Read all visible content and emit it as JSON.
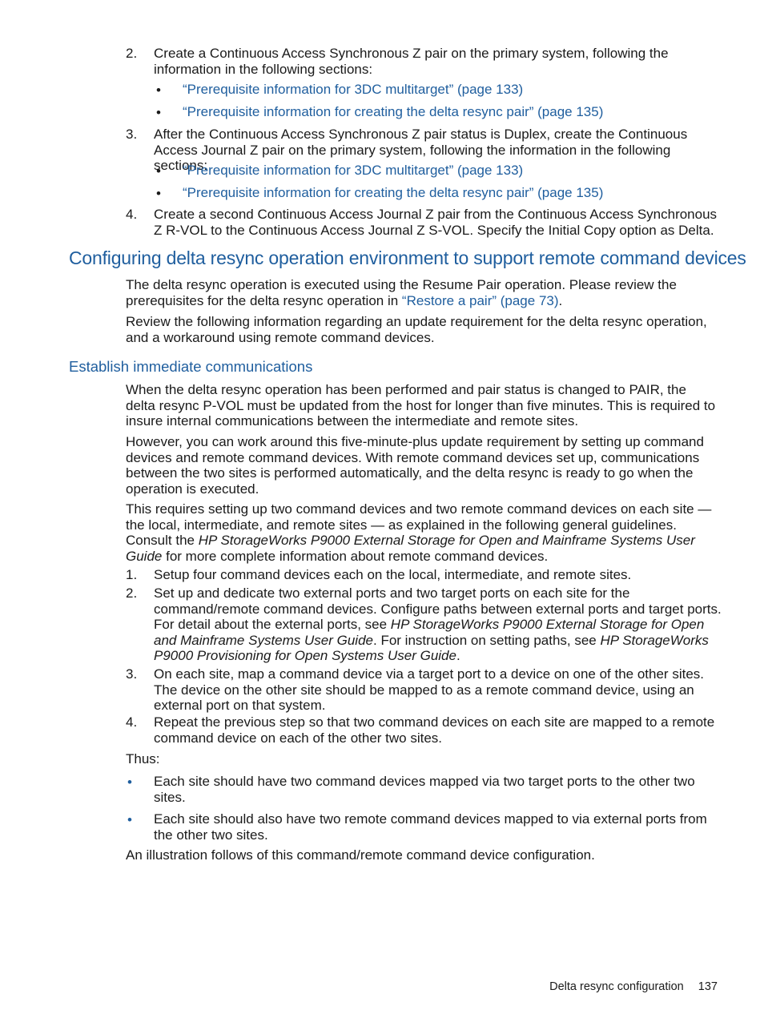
{
  "list_top": [
    {
      "number": "2.",
      "text": "Create a Continuous Access Synchronous Z pair on the primary system, following the information in the following sections:",
      "links": [
        "“Prerequisite information for 3DC multitarget” (page 133)",
        "“Prerequisite information for creating the delta resync pair” (page 135)"
      ]
    },
    {
      "number": "3.",
      "text": "After the Continuous Access Synchronous Z pair status is Duplex, create the Continuous Access Journal Z pair on the primary system, following the information in the following sections:",
      "links": [
        "“Prerequisite information for 3DC multitarget” (page 133)",
        "“Prerequisite information for creating the delta resync pair” (page 135)"
      ]
    },
    {
      "number": "4.",
      "text": "Create a second Continuous Access Journal Z pair from the Continuous Access Synchronous Z R-VOL to the Continuous Access Journal Z S-VOL. Specify the Initial Copy option as Delta."
    }
  ],
  "section": {
    "heading": "Configuring delta resync operation environment to support remote command devices",
    "para1_before": "The delta resync operation is executed using the Resume Pair operation. Please review the prerequisites for the delta resync operation in ",
    "para1_link": "“Restore a pair” (page 73)",
    "para1_after": ".",
    "para2": "Review the following information regarding an update requirement for the delta resync operation, and a workaround using remote command devices."
  },
  "subsection": {
    "heading": "Establish immediate communications",
    "para1": "When the delta resync operation has been performed and pair status is changed to PAIR, the delta resync P-VOL must be updated from the host for longer than five minutes. This is required to insure internal communications between the intermediate and remote sites.",
    "para2": "However, you can work around this five-minute-plus update requirement by setting up command devices and remote command devices. With remote command devices set up, communications between the two sites is performed automatically, and the delta resync is ready to go when the operation is executed.",
    "para3_before": "This requires setting up two command devices and two remote command devices on each site — the local, intermediate, and remote sites — as explained in the following general guidelines. Consult the ",
    "para3_italic": "HP StorageWorks P9000 External Storage for Open and Mainframe Systems User Guide",
    "para3_after": " for more complete information about remote command devices.",
    "steps": [
      {
        "number": "1.",
        "text": "Setup four command devices each on the local, intermediate, and remote sites."
      },
      {
        "number": "2.",
        "t1": "Set up and dedicate two external ports and two target ports on each site for the command/remote command devices. Configure paths between external ports and target ports. For detail about the external ports, see ",
        "i1": "HP StorageWorks P9000 External Storage for Open and Mainframe Systems User Guide",
        "t2": ". For instruction on setting paths, see ",
        "i2": "HP StorageWorks P9000 Provisioning for Open Systems User Guide",
        "t3": "."
      },
      {
        "number": "3.",
        "text": "On each site, map a command device via a target port to a device on one of the other sites. The device on the other site should be mapped to as a remote command device, using an external port on that system."
      },
      {
        "number": "4.",
        "text": "Repeat the previous step so that two command devices on each site are mapped to a remote command device on each of the other two sites."
      }
    ],
    "thus": "Thus:",
    "bullets": [
      "Each site should have two command devices mapped via two target ports to the other two sites.",
      "Each site should also have two remote command devices mapped to via external ports from the other two sites."
    ],
    "closing": "An illustration follows of this command/remote command device configuration."
  },
  "footer": {
    "section_title": "Delta resync configuration",
    "page_number": "137"
  }
}
